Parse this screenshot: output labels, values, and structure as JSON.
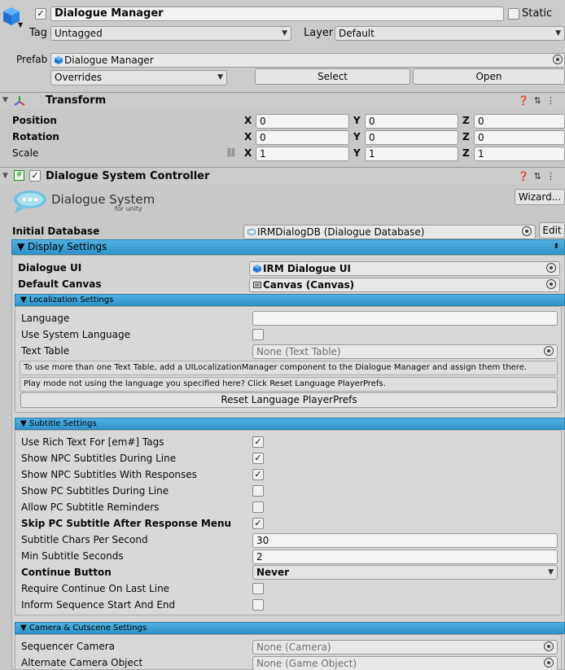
{
  "gameobject": {
    "name": "Dialogue Manager",
    "static_label": "Static",
    "tag_label": "Tag",
    "tag_value": "Untagged",
    "layer_label": "Layer",
    "layer_value": "Default",
    "prefab_label": "Prefab",
    "prefab_value": "Dialogue Manager",
    "overrides_label": "Overrides",
    "select_label": "Select",
    "open_label": "Open"
  },
  "transform": {
    "title": "Transform",
    "rows": [
      {
        "label": "Position",
        "x": "0",
        "y": "0",
        "z": "0"
      },
      {
        "label": "Rotation",
        "x": "0",
        "y": "0",
        "z": "0"
      },
      {
        "label": "Scale",
        "x": "1",
        "y": "1",
        "z": "1"
      }
    ],
    "axis_x": "X",
    "axis_y": "Y",
    "axis_z": "Z"
  },
  "controller": {
    "title": "Dialogue System Controller",
    "logo_main": "Dialogue System",
    "logo_sub": "for unity",
    "wizard_label": "Wizard...",
    "initial_db_label": "Initial Database",
    "initial_db_value": "IRMDialogDB (Dialogue Database)",
    "edit_label": "Edit",
    "display_settings": "▼ Display Settings",
    "dialogue_ui_label": "Dialogue UI",
    "dialogue_ui_value": "IRM Dialogue UI",
    "default_canvas_label": "Default Canvas",
    "default_canvas_value": "Canvas (Canvas)"
  },
  "localization": {
    "header": "▼ Localization Settings",
    "language_label": "Language",
    "language_value": "",
    "use_system_label": "Use System Language",
    "text_table_label": "Text Table",
    "text_table_value": "None (Text Table)",
    "info1": "To use more than one Text Table, add a UILocalizationManager component to the Dialogue Manager and assign them there.",
    "info2": "Play mode not using the language you specified here? Click Reset Language PlayerPrefs.",
    "reset_label": "Reset Language PlayerPrefs"
  },
  "subtitle": {
    "header": "▼ Subtitle Settings",
    "rows": [
      {
        "label": "Use Rich Text For [em#] Tags",
        "checked": "✓"
      },
      {
        "label": "Show NPC Subtitles During Line",
        "checked": "✓"
      },
      {
        "label": "Show NPC Subtitles With Responses",
        "checked": "✓"
      },
      {
        "label": "Show PC Subtitles During Line",
        "checked": ""
      },
      {
        "label": "Allow PC Subtitle Reminders",
        "checked": ""
      },
      {
        "label": "Skip PC Subtitle After Response Menu",
        "checked": "✓"
      }
    ],
    "chars_label": "Subtitle Chars Per Second",
    "chars_value": "30",
    "min_label": "Min Subtitle Seconds",
    "min_value": "2",
    "continue_label": "Continue Button",
    "continue_value": "Never",
    "require_label": "Require Continue On Last Line",
    "inform_label": "Inform Sequence Start And End"
  },
  "camera": {
    "header": "▼ Camera & Cutscene Settings",
    "sequencer_label": "Sequencer Camera",
    "sequencer_value": "None (Camera)",
    "alternate_label": "Alternate Camera Object",
    "alternate_value": "None (Game Object)"
  }
}
